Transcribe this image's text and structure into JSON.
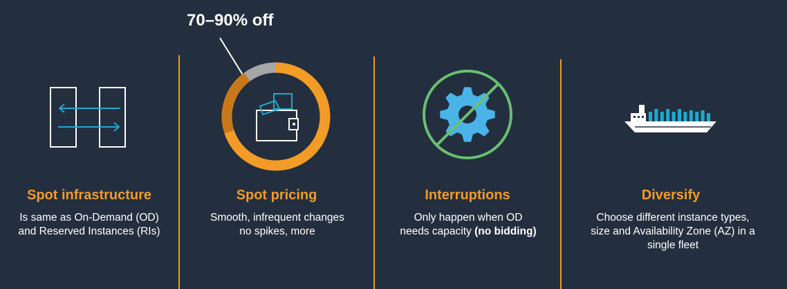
{
  "callout": "70–90% off",
  "colors": {
    "background": "#232f3e",
    "accent": "#f29b26",
    "dark_accent": "#c8781b",
    "ring_gray": "#a6a6a6",
    "teal": "#1fa9cf",
    "gear_blue": "#4ab4e8",
    "slash_green": "#6abf73"
  },
  "columns": [
    {
      "title": "Spot infrastructure",
      "lines": [
        "Is same as On-Demand (OD)",
        "and Reserved Instances (RIs)"
      ],
      "icon": "transfer-arrows-icon"
    },
    {
      "title": "Spot pricing",
      "lines": [
        "Smooth, infrequent changes",
        "no spikes, more"
      ],
      "icon": "wallet-icon"
    },
    {
      "title": "Interruptions",
      "lines": [
        "Only happen when OD",
        "needs capacity ",
        "(no bidding)"
      ],
      "icon": "gear-crossed-icon"
    },
    {
      "title": "Diversify",
      "lines": [
        "Choose different instance types,",
        "size and Availability Zone (AZ) in a",
        "single fleet"
      ],
      "icon": "container-ship-icon"
    }
  ],
  "donut": {
    "discount_fraction_low": 0.7,
    "discount_fraction_high": 0.9
  }
}
